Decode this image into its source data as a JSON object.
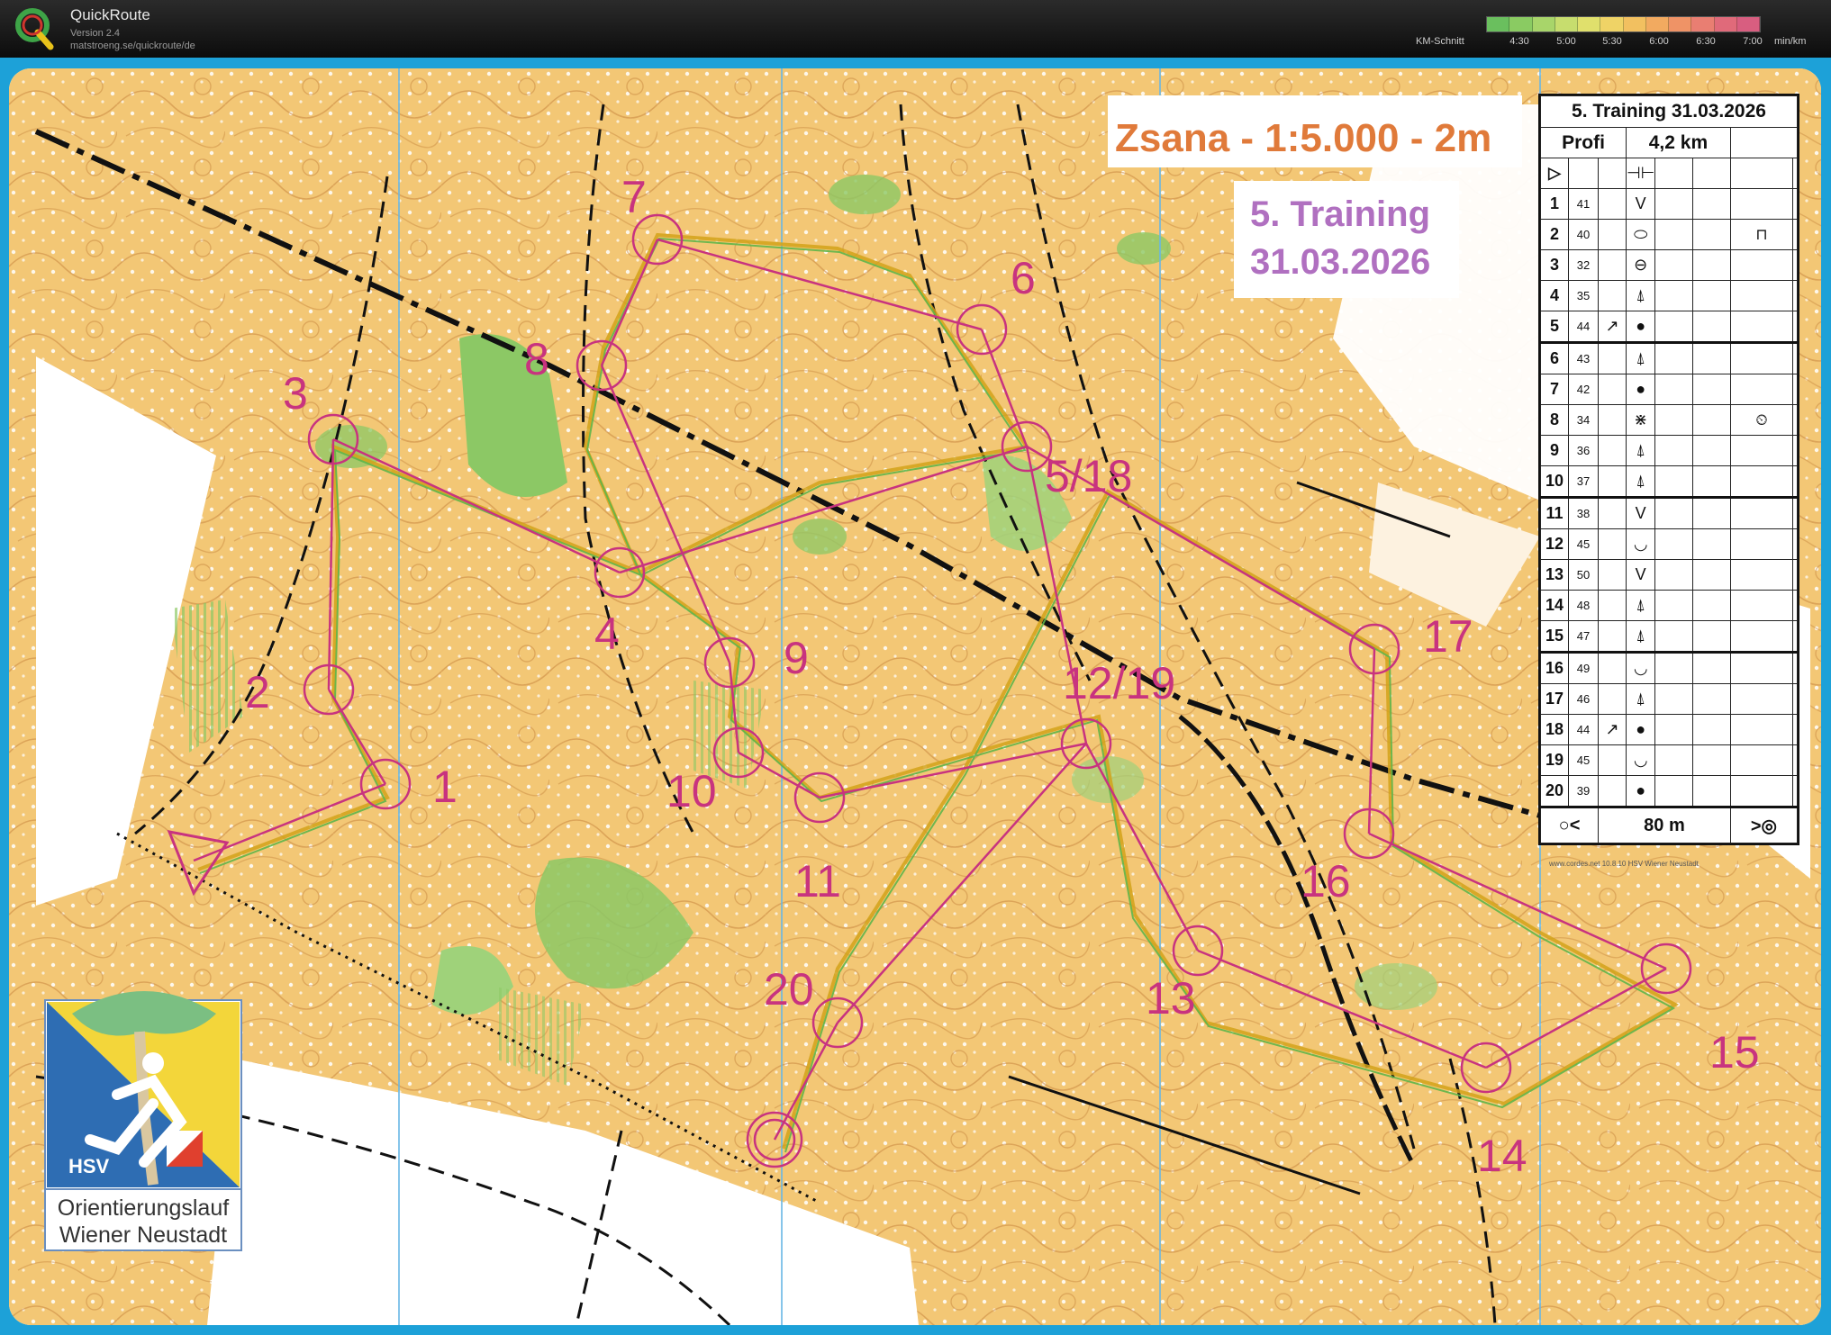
{
  "app": {
    "name": "QuickRoute",
    "version": "Version 2.4",
    "url": "matstroeng.se/quickroute/de",
    "speed_label": "KM-Schnitt",
    "speed_ticks": [
      "4:30",
      "5:00",
      "5:30",
      "6:00",
      "6:30",
      "7:00"
    ],
    "speed_unit": "min/km",
    "speed_colors": [
      "#6abf5e",
      "#8acb62",
      "#a8d56a",
      "#c7dd6e",
      "#e0e06c",
      "#efd366",
      "#f2c060",
      "#f2aa60",
      "#ef9366",
      "#e97e72",
      "#e06a7a",
      "#d85e80"
    ]
  },
  "map": {
    "title": "Zsana - 1:5.000 - 2m",
    "training_title": "5. Training",
    "training_date": "31.03.2026",
    "club_logo_text": "HSV",
    "club_name_1": "Orientierungslauf",
    "club_name_2": "Wiener Neustadt",
    "printer_note": "www.cordes.net 10.8.10 HSV Wiener Neustadt",
    "course_color": "#c8337f",
    "control_labels": [
      "1",
      "2",
      "3",
      "4",
      "5/18",
      "6",
      "7",
      "8",
      "9",
      "10",
      "11",
      "12/19",
      "13",
      "14",
      "15",
      "16",
      "17",
      "20"
    ]
  },
  "legend": {
    "title": "5. Training 31.03.2026",
    "class": "Profi",
    "length": "4,2 km",
    "start_symbol": "▷",
    "start_feature": "⊣⊢",
    "rows": [
      {
        "n": "1",
        "code": "41",
        "dir": "",
        "feat": "V",
        "extra": ""
      },
      {
        "n": "2",
        "code": "40",
        "dir": "",
        "feat": "⬭",
        "extra": "⊓"
      },
      {
        "n": "3",
        "code": "32",
        "dir": "",
        "feat": "⊖",
        "extra": ""
      },
      {
        "n": "4",
        "code": "35",
        "dir": "",
        "feat": "⍋",
        "extra": ""
      },
      {
        "n": "5",
        "code": "44",
        "dir": "↗",
        "feat": "●",
        "extra": ""
      },
      {
        "n": "6",
        "code": "43",
        "dir": "",
        "feat": "⍋",
        "extra": ""
      },
      {
        "n": "7",
        "code": "42",
        "dir": "",
        "feat": "●",
        "extra": ""
      },
      {
        "n": "8",
        "code": "34",
        "dir": "",
        "feat": "⋇",
        "extra": "⏲"
      },
      {
        "n": "9",
        "code": "36",
        "dir": "",
        "feat": "⍋",
        "extra": ""
      },
      {
        "n": "10",
        "code": "37",
        "dir": "",
        "feat": "⍋",
        "extra": ""
      },
      {
        "n": "11",
        "code": "38",
        "dir": "",
        "feat": "V",
        "extra": ""
      },
      {
        "n": "12",
        "code": "45",
        "dir": "",
        "feat": "◡",
        "extra": ""
      },
      {
        "n": "13",
        "code": "50",
        "dir": "",
        "feat": "V",
        "extra": ""
      },
      {
        "n": "14",
        "code": "48",
        "dir": "",
        "feat": "⍋",
        "extra": ""
      },
      {
        "n": "15",
        "code": "47",
        "dir": "",
        "feat": "⍋",
        "extra": ""
      },
      {
        "n": "16",
        "code": "49",
        "dir": "",
        "feat": "◡",
        "extra": ""
      },
      {
        "n": "17",
        "code": "46",
        "dir": "",
        "feat": "⍋",
        "extra": ""
      },
      {
        "n": "18",
        "code": "44",
        "dir": "↗",
        "feat": "●",
        "extra": ""
      },
      {
        "n": "19",
        "code": "45",
        "dir": "",
        "feat": "◡",
        "extra": ""
      },
      {
        "n": "20",
        "code": "39",
        "dir": "",
        "feat": "●",
        "extra": ""
      }
    ],
    "finish_left": "○<",
    "finish_distance": "80 m",
    "finish_right": ">◎"
  }
}
